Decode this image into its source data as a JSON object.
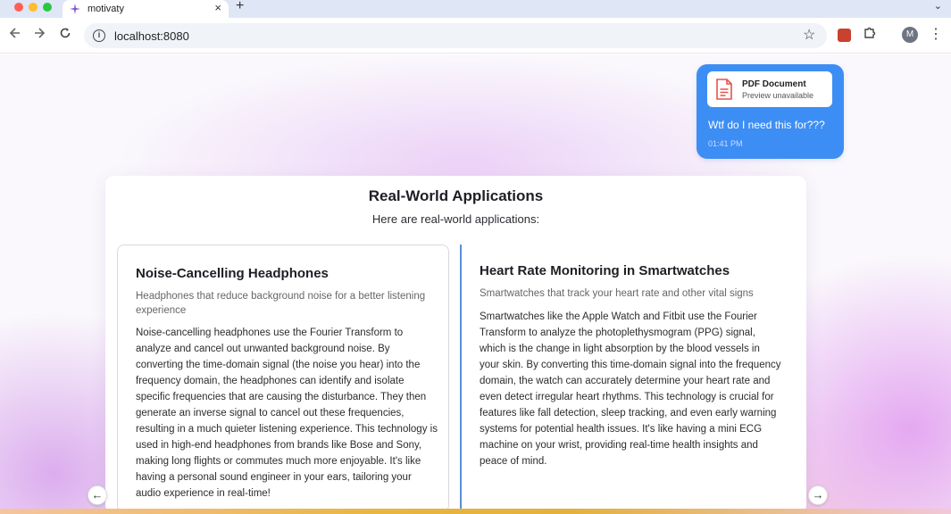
{
  "browser": {
    "tab_title": "motivaty",
    "tab_close": "×",
    "new_tab": "+",
    "tab_menu": "⌄",
    "url": "localhost:8080",
    "avatar_initial": "M",
    "window_colors": {
      "close": "#ff5f57",
      "minimize": "#febc2e",
      "maximize": "#28c840"
    }
  },
  "chat": {
    "attachment_title": "PDF Document",
    "attachment_subtitle": "Preview unavailable",
    "message": "Wtf do I need this for???",
    "time": "01:41 PM",
    "bubble_color": "#3d8ef4"
  },
  "card": {
    "title": "Real-World Applications",
    "subtitle": "Here are real-world applications:",
    "applications": [
      {
        "title": "Noise-Cancelling Headphones",
        "description": "Headphones that reduce background noise for a better listening experience",
        "body": "Noise-cancelling headphones use the Fourier Transform to analyze and cancel out unwanted background noise. By converting the time-domain signal (the noise you hear) into the frequency domain, the headphones can identify and isolate specific frequencies that are causing the disturbance. They then generate an inverse signal to cancel out these frequencies, resulting in a much quieter listening experience. This technology is used in high-end headphones from brands like Bose and Sony, making long flights or commutes much more enjoyable. It's like having a personal sound engineer in your ears, tailoring your audio experience in real-time!"
      },
      {
        "title": "Heart Rate Monitoring in Smartwatches",
        "description": "Smartwatches that track your heart rate and other vital signs",
        "body": "Smartwatches like the Apple Watch and Fitbit use the Fourier Transform to analyze the photoplethysmogram (PPG) signal, which is the change in light absorption by the blood vessels in your skin. By converting this time-domain signal into the frequency domain, the watch can accurately determine your heart rate and even detect irregular heart rhythms. This technology is crucial for features like fall detection, sleep tracking, and even early warning systems for potential health issues. It's like having a mini ECG machine on your wrist, providing real-time health insights and peace of mind."
      }
    ],
    "prev_arrow": "←",
    "next_arrow": "→",
    "accent_color": "#5b8ed8"
  }
}
